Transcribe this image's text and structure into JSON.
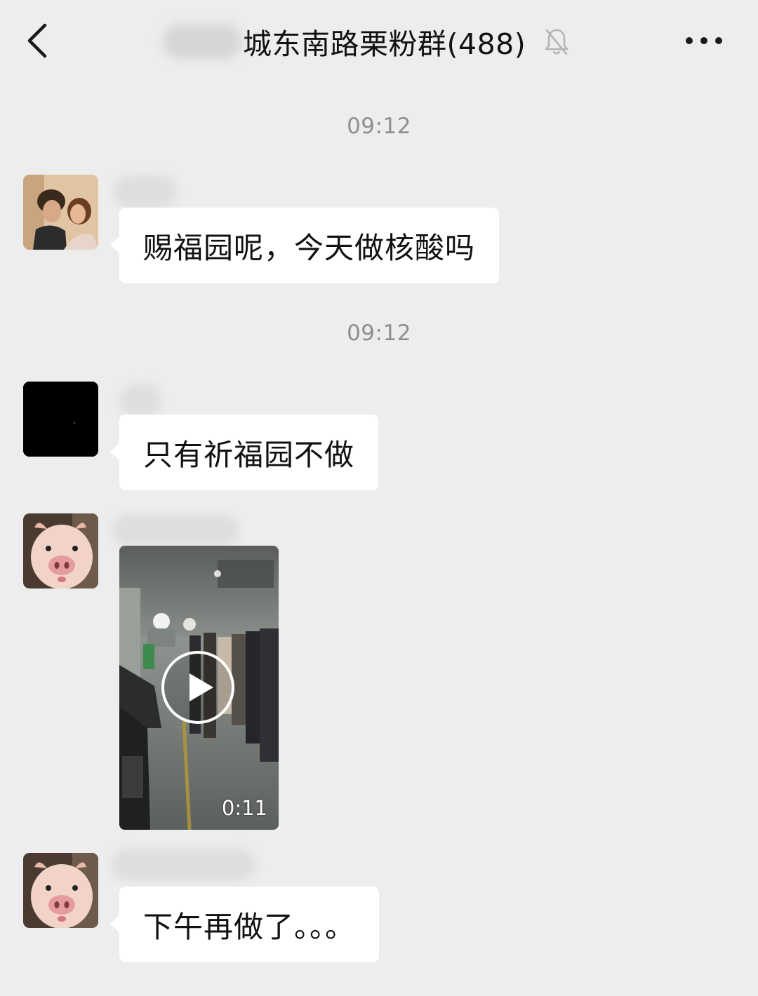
{
  "header": {
    "title": "城东南路栗粉群(488)",
    "back_icon": "chevron-left-icon",
    "mute_icon": "bell-off-icon",
    "more_icon": "ellipsis-icon"
  },
  "messages": [
    {
      "time": "09:12",
      "avatar": "couple-photo-avatar",
      "text": "赐福园呢，今天做核酸吗"
    },
    {
      "time": "09:12",
      "avatar": "black-avatar",
      "text": "只有祈福园不做"
    },
    {
      "avatar": "piglet-avatar",
      "video": {
        "duration": "0:11",
        "play_icon": "play-icon"
      }
    },
    {
      "avatar": "piglet-avatar",
      "text": "下午再做了。。。"
    }
  ],
  "colors": {
    "background": "#ededed",
    "bubble": "#ffffff",
    "timestamp": "#8e8e8e"
  }
}
